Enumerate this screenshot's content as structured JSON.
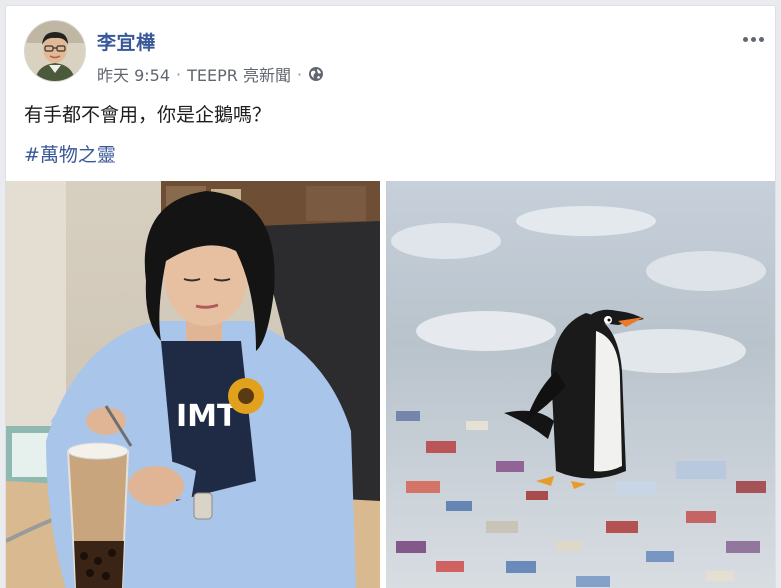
{
  "post": {
    "author_name": "李宜樺",
    "timestamp": "昨天 9:54",
    "source": "TEEPR 亮新聞",
    "separator": "·",
    "body_text": "有手都不會用，你是企鵝嗎？",
    "hashtag": "#萬物之靈",
    "privacy_icon": "globe-icon",
    "menu_icon": "more-options-icon"
  },
  "photos": {
    "left": {
      "subject": "woman-drinking-bubble-tea",
      "shirt_text": "IMT"
    },
    "right": {
      "subject": "penguin-on-ice-with-debris"
    }
  },
  "colors": {
    "link": "#385898",
    "meta": "#606770",
    "text": "#1c1e21",
    "page_bg": "#e9ebee",
    "card_bg": "#ffffff"
  }
}
